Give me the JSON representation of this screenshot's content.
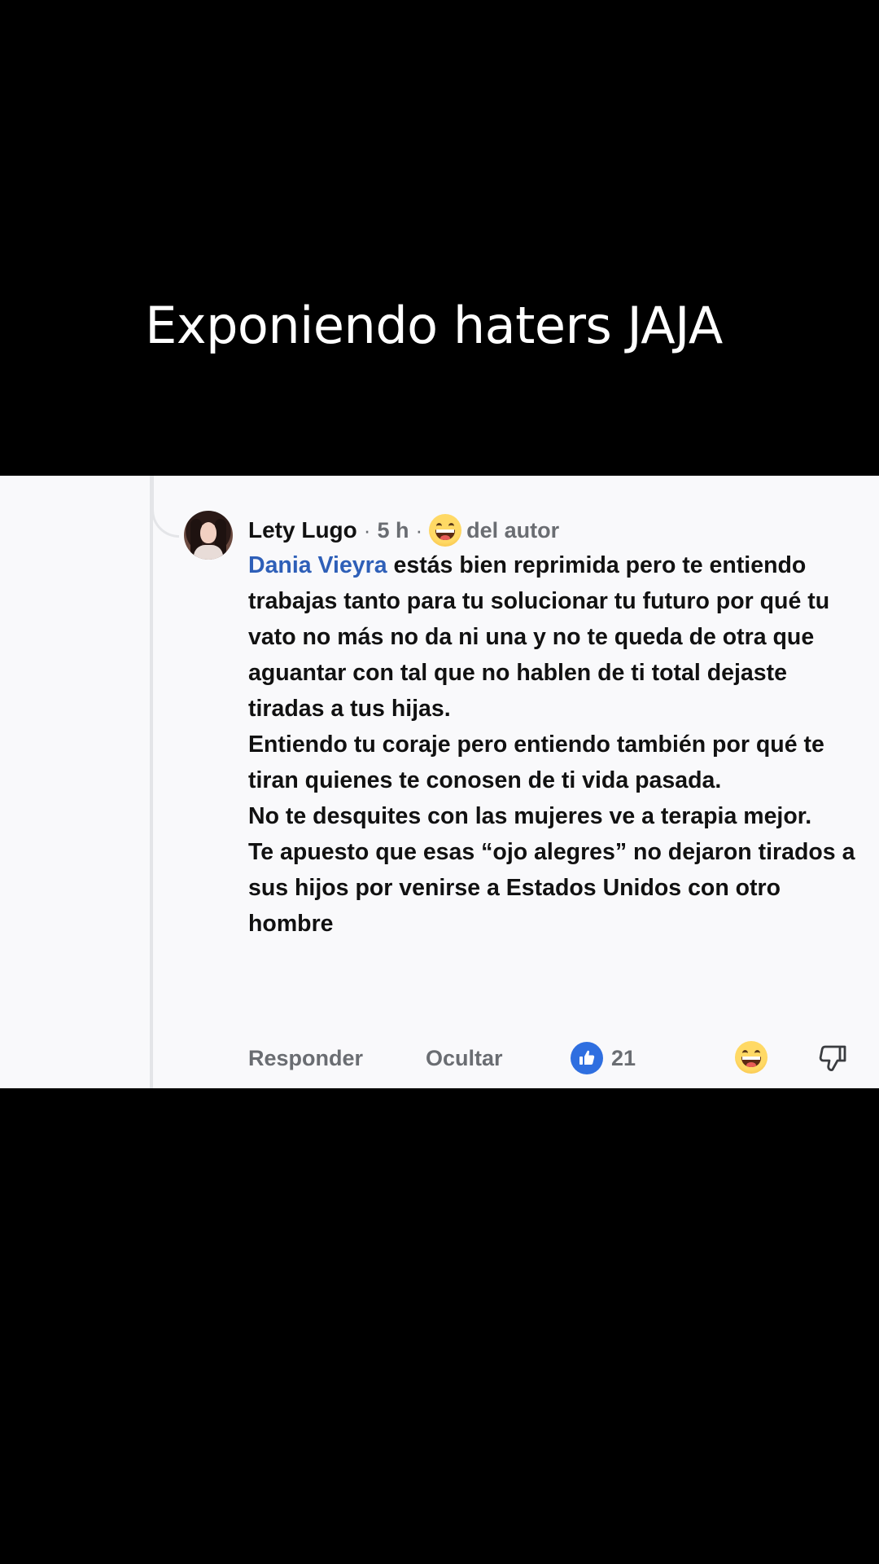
{
  "overlay": {
    "caption": "Exponiendo haters JAJA"
  },
  "comment": {
    "author": "Lety Lugo",
    "time": "5 h",
    "separator": "·",
    "author_badge": "del autor",
    "mention": "Dania Vieyra",
    "paragraphs": [
      " estás bien reprimida pero te entiendo trabajas tanto para tu solucionar tu futuro por qué tu vato no más no da ni una y no te queda de otra que aguantar con tal que no hablen de ti total dejaste tiradas a tus hijas.",
      "Entiendo tu coraje pero entiendo también por qué te tiran quienes te conosen de ti vida pasada.",
      "No te desquites con las mujeres ve a terapia mejor.",
      "Te apuesto que esas “ojo alegres” no dejaron tirados a sus hijos por venirse a Estados Unidos con otro hombre"
    ]
  },
  "actions": {
    "reply_label": "Responder",
    "hide_label": "Ocultar",
    "like_count": "21"
  },
  "colors": {
    "mention": "#2e5fb8",
    "like": "#2f6fe0",
    "muted": "#6a6d72"
  },
  "icons": {
    "like": "thumbs-up-icon",
    "reaction": "grinning-face-emoji",
    "dislike": "thumbs-down-icon"
  }
}
